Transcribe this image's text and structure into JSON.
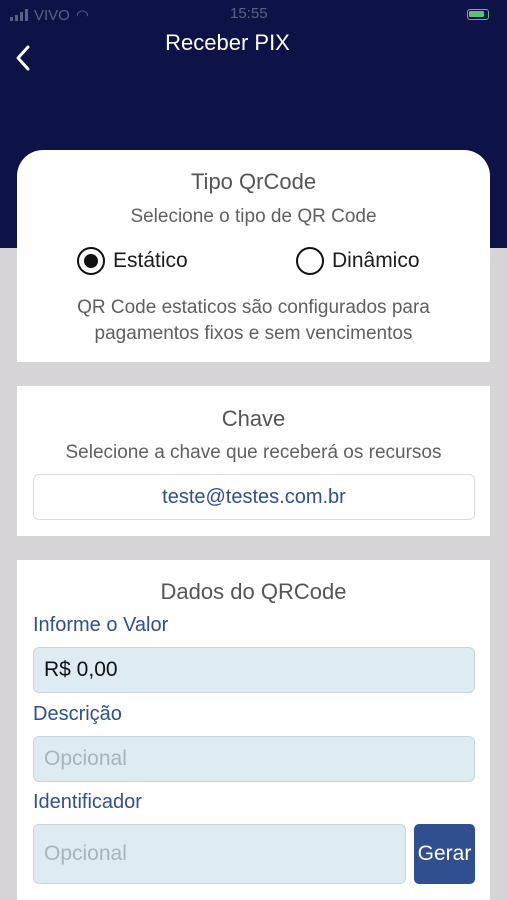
{
  "status_bar": {
    "carrier": "VIVO",
    "time": "15:55"
  },
  "header": {
    "title": "Receber PIX",
    "back_icon": "chevron-left-icon"
  },
  "tipo_qrcode": {
    "title": "Tipo QrCode",
    "subtitle": "Selecione o tipo de QR Code",
    "options": [
      {
        "label": "Estático",
        "selected": true
      },
      {
        "label": "Dinâmico",
        "selected": false
      }
    ],
    "description_line1": "QR Code estaticos são configurados para",
    "description_line2": "pagamentos fixos e sem vencimentos"
  },
  "chave": {
    "title": "Chave",
    "subtitle": "Selecione a chave que receberá os recursos",
    "value": "teste@testes.com.br"
  },
  "dados": {
    "title": "Dados do QRCode",
    "valor_label": "Informe o Valor",
    "valor_value": "R$ 0,00",
    "descricao_label": "Descrição",
    "descricao_placeholder": "Opcional",
    "identificador_label": "Identificador",
    "identificador_placeholder": "Opcional",
    "gerar_label": "Gerar"
  },
  "colors": {
    "header_bg": "#0d1346",
    "accent": "#2f4f8f",
    "input_bg": "#deebf1",
    "page_bg": "#d6d4d6"
  }
}
